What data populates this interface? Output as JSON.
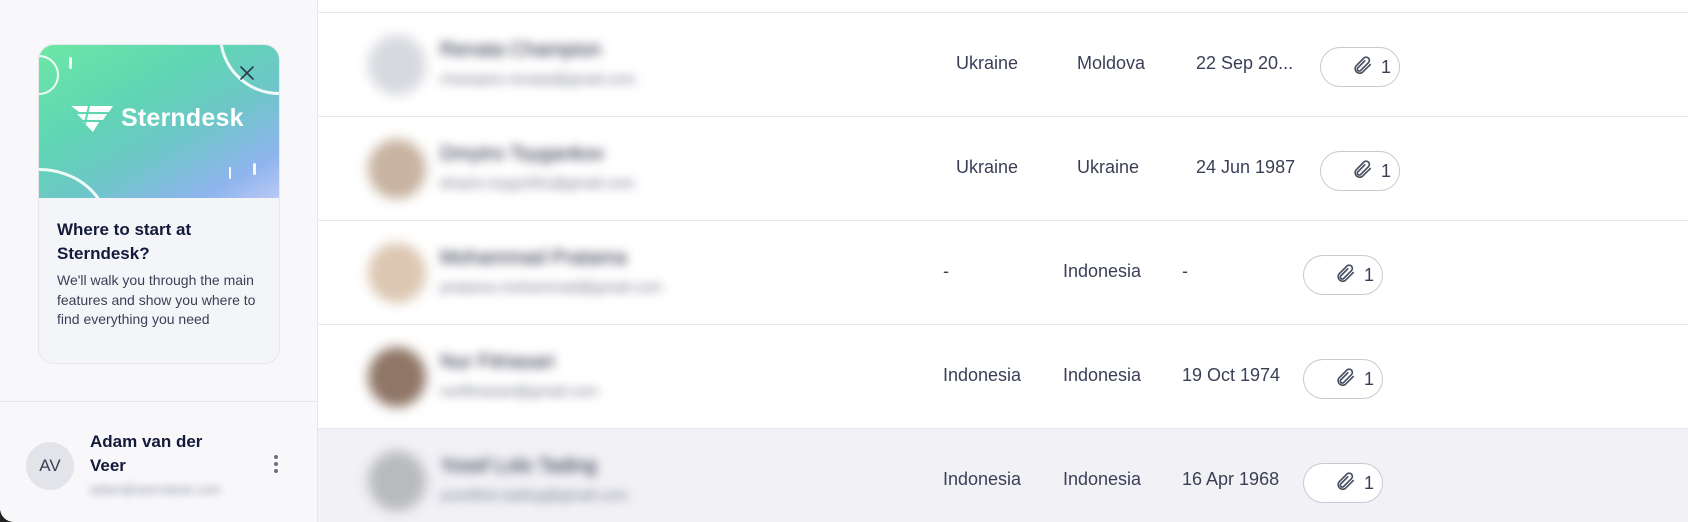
{
  "sidebar": {
    "promo": {
      "brand": "Sterndesk",
      "title": "Where to start at Sterndesk?",
      "text": "We'll walk you through the main features and show you where to find everything you need"
    },
    "user": {
      "initials": "AV",
      "name": "Adam van der Veer",
      "email": "adam@sterndesk.com"
    }
  },
  "table": {
    "rows": [
      {
        "name": "Renata Champion",
        "email": "champion.renata@gmail.com",
        "photo_color": "#d7d9df",
        "col1": "Ukraine",
        "col2": "Moldova",
        "col3": "22 Sep 20...",
        "attachments": "1"
      },
      {
        "name": "Dmytro Tsygankov",
        "email": "dmytro.tsyg1991@gmail.com",
        "photo_color": "#c8b3a0",
        "col1": "Ukraine",
        "col2": "Ukraine",
        "col3": "24 Jun 1987",
        "attachments": "1"
      },
      {
        "name": "Mohammad Pratama",
        "email": "pratama.mohammad@gmail.com",
        "photo_color": "#dcc7b2",
        "col1": "-",
        "col2": "Indonesia",
        "col3": "-",
        "attachments": "1"
      },
      {
        "name": "Nur Fitriasari",
        "email": "nurfitriasari@gmail.com",
        "photo_color": "#8f7666",
        "col1": "Indonesia",
        "col2": "Indonesia",
        "col3": "19 Oct 1974",
        "attachments": "1"
      },
      {
        "name": "Yosef Lolo Tading",
        "email": "yoseflolo.tading@gmail.com",
        "photo_color": "#b8babe",
        "col1": "Indonesia",
        "col2": "Indonesia",
        "col3": "16 Apr 1968",
        "attachments": "1"
      }
    ]
  }
}
